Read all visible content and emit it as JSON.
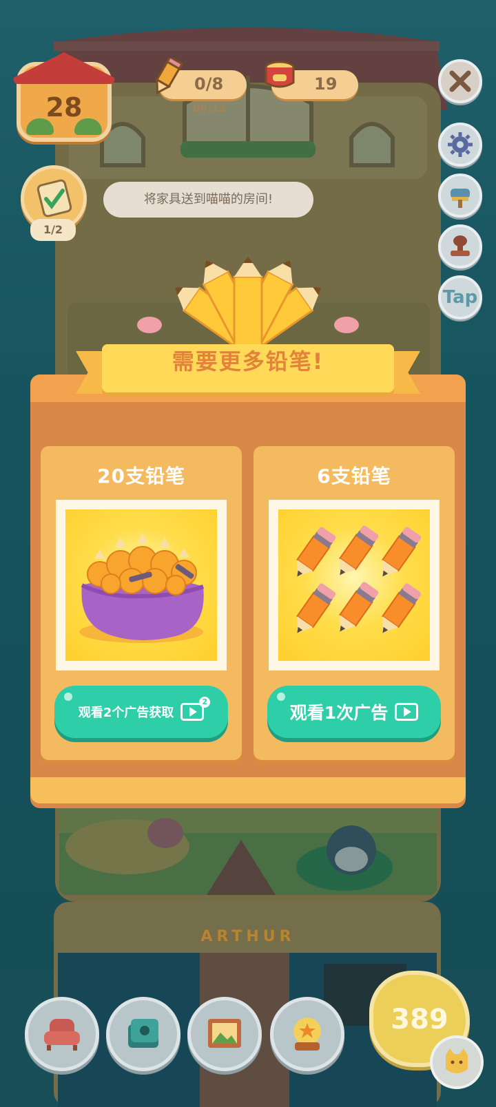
{
  "hud": {
    "level": "28",
    "pencils": "0/8",
    "timer": "00:12",
    "cans": "19",
    "task_progress": "1/2",
    "task_tip": "将家具送到喵喵的房间!",
    "tap_label": "Tap"
  },
  "dialog": {
    "title": "需要更多铅笔!",
    "offers": [
      {
        "label": "20支铅笔",
        "button": "观看2个广告获取",
        "ad_count": "2",
        "image": "pencil-bag-icon"
      },
      {
        "label": "6支铅笔",
        "button": "观看1次广告",
        "image": "six-pencils-icon"
      }
    ]
  },
  "room": {
    "name": "ARTHUR"
  },
  "bottom": {
    "coins": "389"
  },
  "colors": {
    "accent_green": "#2ecfa8",
    "panel_orange": "#f2a14f",
    "ribbon_yellow": "#ffd957",
    "title_orange": "#e2833c"
  }
}
